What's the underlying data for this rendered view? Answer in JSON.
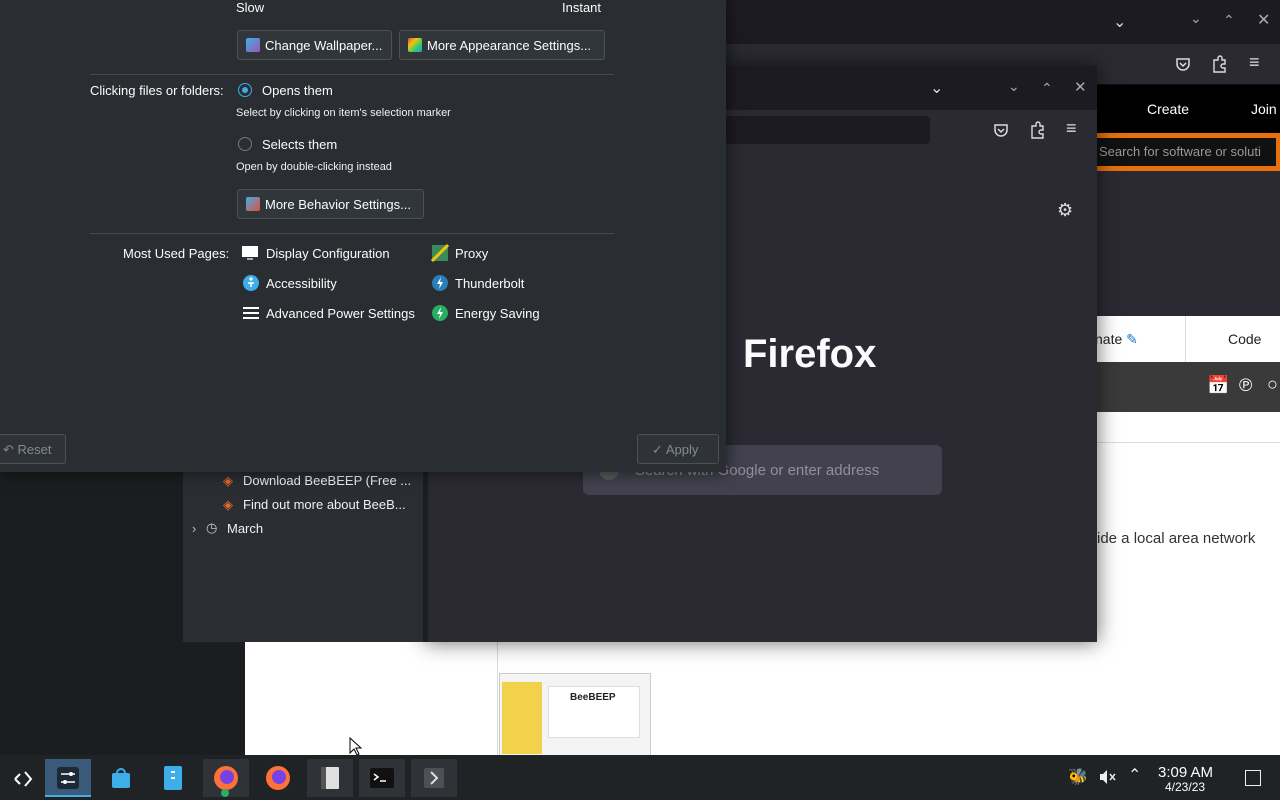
{
  "background_browser": {
    "nav": {
      "create": "Create",
      "join": "Join"
    },
    "search_placeholder": "Search for software or soluti",
    "tabs": {
      "donate": "nate",
      "code": "Code"
    },
    "body_text": "ide a local area network"
  },
  "firefox": {
    "brand": "Firefox",
    "search_placeholder": "Search with Google or enter address"
  },
  "library": {
    "items": [
      {
        "label": "Download BeeBEEP (Free ..."
      },
      {
        "label": "Find out more about BeeB..."
      }
    ],
    "folder": "March"
  },
  "settings": {
    "slider_min": "Slow",
    "slider_max": "Instant",
    "change_wallpaper": "Change Wallpaper...",
    "more_appearance": "More Appearance Settings...",
    "clicking_label": "Clicking files or folders:",
    "opens_them": "Opens them",
    "opens_hint": "Select by clicking on item's selection marker",
    "selects_them": "Selects them",
    "selects_hint": "Open by double-clicking instead",
    "more_behavior": "More Behavior Settings...",
    "most_used_label": "Most Used Pages:",
    "pages": {
      "display": "Display Configuration",
      "proxy": "Proxy",
      "accessibility": "Accessibility",
      "thunderbolt": "Thunderbolt",
      "power": "Advanced Power Settings",
      "energy": "Energy Saving"
    },
    "reset": "Reset",
    "apply": "Apply",
    "clicking_mode": "opens"
  },
  "tray": {
    "time": "3:09 AM",
    "date": "4/23/23"
  },
  "colors": {
    "accent": "#3daee9",
    "orange": "#e8700a"
  }
}
